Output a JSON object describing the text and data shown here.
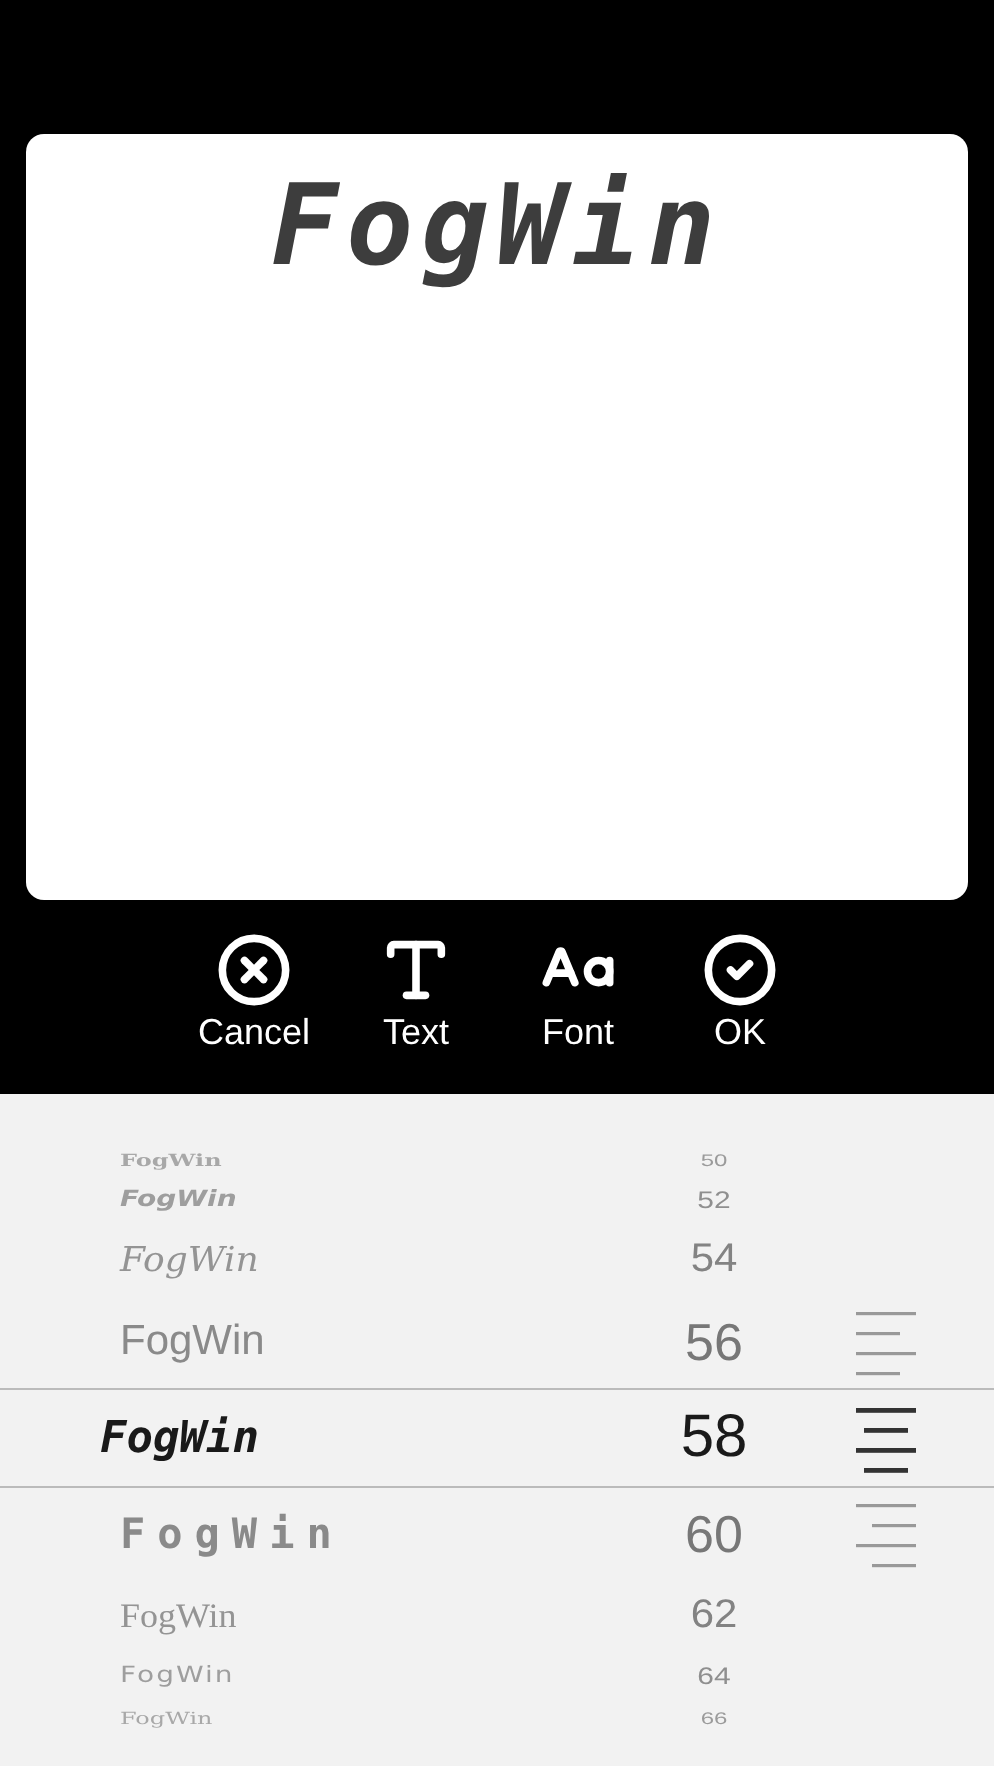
{
  "canvas": {
    "text": "FogWin"
  },
  "toolbar": [
    {
      "kind": "cancel",
      "label": "Cancel"
    },
    {
      "kind": "text",
      "label": "Text"
    },
    {
      "kind": "font",
      "label": "Font"
    },
    {
      "kind": "ok",
      "label": "OK"
    }
  ],
  "picker": [
    {
      "font_sample": "FogWin",
      "size": "50",
      "selected": false
    },
    {
      "font_sample": "FogWin",
      "size": "52",
      "selected": false
    },
    {
      "font_sample": "FogWin",
      "size": "54",
      "selected": false
    },
    {
      "font_sample": "FogWin",
      "size": "56",
      "kind": "left",
      "selected": false
    },
    {
      "font_sample": "FogWin",
      "size": "58",
      "kind": "center",
      "selected": true
    },
    {
      "font_sample": "FogWin",
      "size": "60",
      "kind": "right",
      "selected": false
    },
    {
      "font_sample": "FogWin",
      "size": "62",
      "selected": false
    },
    {
      "font_sample": "FogWin",
      "size": "64",
      "selected": false
    },
    {
      "font_sample": "FogWin",
      "size": "66",
      "selected": false
    }
  ]
}
